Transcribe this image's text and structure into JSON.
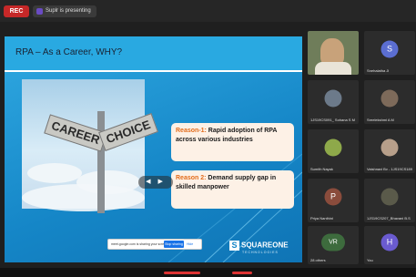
{
  "header": {
    "rec_label": "REC",
    "presenter_text": "Suplr is presenting"
  },
  "slide": {
    "title": "RPA – As a Career, WHY?",
    "sign_left": "CAREER",
    "sign_right": "CHOICE",
    "reasons": [
      {
        "label": "Reason-1:",
        "text": "Rapid adoption of RPA across various industries"
      },
      {
        "label": "Reason 2:",
        "text": "Demand supply gap in skilled manpower"
      }
    ],
    "share_bar": {
      "message": "meet.google.com is sharing your screen.",
      "stop_label": "Stop sharing",
      "hide_label": "Hide"
    },
    "logo_text": "SQUAREONE",
    "logo_sub": "TECHNOLOGIES"
  },
  "participants": [
    {
      "name": "",
      "initial": "",
      "color": "#4a5a3a"
    },
    {
      "name": "Snehalatha Ji",
      "initial": "S",
      "color": "#5b6ed1"
    },
    {
      "name": "1JS19CS091_ Sohana S M",
      "initial": "",
      "color": "#6c7a8a"
    },
    {
      "name": "Sreelekshmi A M",
      "initial": "",
      "color": "#7d6a5a"
    },
    {
      "name": "Sumith Nayak",
      "initial": "",
      "color": "#8ea94a"
    },
    {
      "name": "Vaishnavi Bv - 1JS19CS189",
      "initial": "",
      "color": "#b79f8a"
    },
    {
      "name": "Priya Nanthini",
      "initial": "P",
      "color": "#8a4c3c"
    },
    {
      "name": "1JS19CS207_Bhavani B.S",
      "initial": "",
      "color": "#5a5a4a"
    },
    {
      "name": "28 others",
      "initial": "VR",
      "color": "#3d6b3d"
    },
    {
      "name": "You",
      "initial": "H",
      "color": "#6a5bd0"
    }
  ]
}
